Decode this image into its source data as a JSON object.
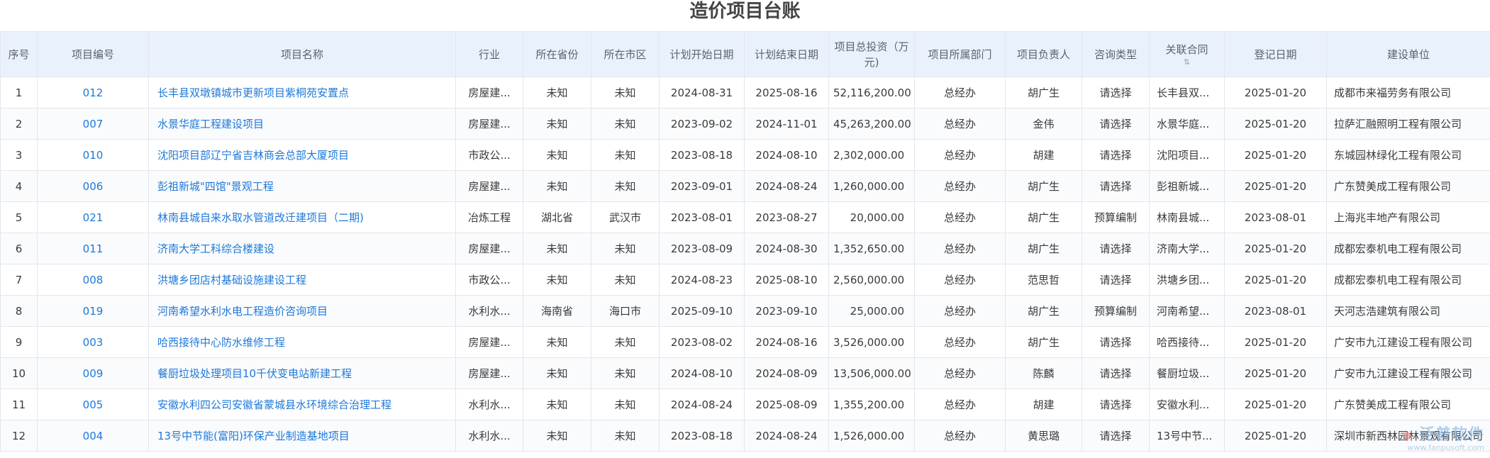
{
  "page": {
    "title": "造价项目台账"
  },
  "table": {
    "columns": [
      "序号",
      "项目编号",
      "项目名称",
      "行业",
      "所在省份",
      "所在市区",
      "计划开始日期",
      "计划结束日期",
      "项目总投资（万元)",
      "项目所属部门",
      "项目负责人",
      "咨询类型",
      "关联合同",
      "登记日期",
      "建设单位"
    ],
    "rows": [
      {
        "seq": "1",
        "code": "012",
        "name": "长丰县双墩镇城市更新项目紫桐苑安置点",
        "industry": "房屋建...",
        "province": "未知",
        "city": "未知",
        "start": "2024-08-31",
        "end": "2025-08-16",
        "investment": "52,116,200.00",
        "dept": "总经办",
        "manager": "胡广生",
        "consult": "请选择",
        "contract": "长丰县双...",
        "reg": "2025-01-20",
        "builder": "成都市来福劳务有限公司"
      },
      {
        "seq": "2",
        "code": "007",
        "name": "水景华庭工程建设项目",
        "industry": "房屋建...",
        "province": "未知",
        "city": "未知",
        "start": "2023-09-02",
        "end": "2024-11-01",
        "investment": "45,263,200.00",
        "dept": "总经办",
        "manager": "金伟",
        "consult": "请选择",
        "contract": "水景华庭...",
        "reg": "2025-01-20",
        "builder": "拉萨汇融照明工程有限公司"
      },
      {
        "seq": "3",
        "code": "010",
        "name": "沈阳项目部辽宁省吉林商会总部大厦项目",
        "industry": "市政公...",
        "province": "未知",
        "city": "未知",
        "start": "2023-08-18",
        "end": "2024-08-10",
        "investment": "2,302,000.00",
        "dept": "总经办",
        "manager": "胡建",
        "consult": "请选择",
        "contract": "沈阳项目...",
        "reg": "2025-01-20",
        "builder": "东城园林绿化工程有限公司"
      },
      {
        "seq": "4",
        "code": "006",
        "name": "彭祖新城\"四馆\"景观工程",
        "industry": "房屋建...",
        "province": "未知",
        "city": "未知",
        "start": "2023-09-01",
        "end": "2024-08-24",
        "investment": "1,260,000.00",
        "dept": "总经办",
        "manager": "胡广生",
        "consult": "请选择",
        "contract": "彭祖新城...",
        "reg": "2025-01-20",
        "builder": "广东赞美成工程有限公司"
      },
      {
        "seq": "5",
        "code": "021",
        "name": "林南县城自来水取水管道改迁建项目（二期)",
        "industry": "冶炼工程",
        "province": "湖北省",
        "city": "武汉市",
        "start": "2023-08-01",
        "end": "2023-08-27",
        "investment": "20,000.00",
        "dept": "总经办",
        "manager": "胡广生",
        "consult": "预算编制",
        "contract": "林南县城...",
        "reg": "2023-08-01",
        "builder": "上海兆丰地产有限公司"
      },
      {
        "seq": "6",
        "code": "011",
        "name": "济南大学工科综合楼建设",
        "industry": "房屋建...",
        "province": "未知",
        "city": "未知",
        "start": "2023-08-09",
        "end": "2024-08-30",
        "investment": "1,352,650.00",
        "dept": "总经办",
        "manager": "胡广生",
        "consult": "请选择",
        "contract": "济南大学...",
        "reg": "2025-01-20",
        "builder": "成都宏泰机电工程有限公司"
      },
      {
        "seq": "7",
        "code": "008",
        "name": "洪塘乡团店村基础设施建设工程",
        "industry": "市政公...",
        "province": "未知",
        "city": "未知",
        "start": "2024-08-23",
        "end": "2025-08-10",
        "investment": "2,560,000.00",
        "dept": "总经办",
        "manager": "范思哲",
        "consult": "请选择",
        "contract": "洪塘乡团...",
        "reg": "2025-01-20",
        "builder": "成都宏泰机电工程有限公司"
      },
      {
        "seq": "8",
        "code": "019",
        "name": "河南希望水利水电工程造价咨询项目",
        "industry": "水利水...",
        "province": "海南省",
        "city": "海口市",
        "start": "2025-09-10",
        "end": "2023-09-10",
        "investment": "25,000.00",
        "dept": "总经办",
        "manager": "胡广生",
        "consult": "预算编制",
        "contract": "河南希望...",
        "reg": "2023-08-01",
        "builder": "天河志浩建筑有限公司"
      },
      {
        "seq": "9",
        "code": "003",
        "name": "哈西接待中心防水维修工程",
        "industry": "房屋建...",
        "province": "未知",
        "city": "未知",
        "start": "2023-08-02",
        "end": "2024-08-16",
        "investment": "3,526,000.00",
        "dept": "总经办",
        "manager": "胡广生",
        "consult": "请选择",
        "contract": "哈西接待...",
        "reg": "2025-01-20",
        "builder": "广安市九江建设工程有限公司"
      },
      {
        "seq": "10",
        "code": "009",
        "name": "餐厨垃圾处理项目10千伏变电站新建工程",
        "industry": "房屋建...",
        "province": "未知",
        "city": "未知",
        "start": "2024-08-10",
        "end": "2024-08-09",
        "investment": "13,506,000.00",
        "dept": "总经办",
        "manager": "陈麟",
        "consult": "请选择",
        "contract": "餐厨垃圾...",
        "reg": "2025-01-20",
        "builder": "广安市九江建设工程有限公司"
      },
      {
        "seq": "11",
        "code": "005",
        "name": "安徽水利四公司安徽省蒙城县水环境综合治理工程",
        "industry": "水利水...",
        "province": "未知",
        "city": "未知",
        "start": "2024-08-24",
        "end": "2025-08-09",
        "investment": "1,355,200.00",
        "dept": "总经办",
        "manager": "胡建",
        "consult": "请选择",
        "contract": "安徽水利...",
        "reg": "2025-01-20",
        "builder": "广东赞美成工程有限公司"
      },
      {
        "seq": "12",
        "code": "004",
        "name": "13号中节能(富阳)环保产业制造基地项目",
        "industry": "水利水...",
        "province": "未知",
        "city": "未知",
        "start": "2023-08-18",
        "end": "2024-08-24",
        "investment": "1,526,000.00",
        "dept": "总经办",
        "manager": "黄思璐",
        "consult": "请选择",
        "contract": "13号中节...",
        "reg": "2025-01-20",
        "builder": "深圳市新西林园林景观有限公司"
      }
    ]
  },
  "watermark": {
    "logo_text": "泛普软件",
    "url": "www.fanpusoft.com"
  },
  "icons": {
    "sort": "sort-icon",
    "watermark_mark": "fanpu-logo-icon"
  },
  "colors": {
    "header_bg": "#e9f2fc",
    "link": "#1e78d8",
    "border": "#e3e6ec"
  }
}
